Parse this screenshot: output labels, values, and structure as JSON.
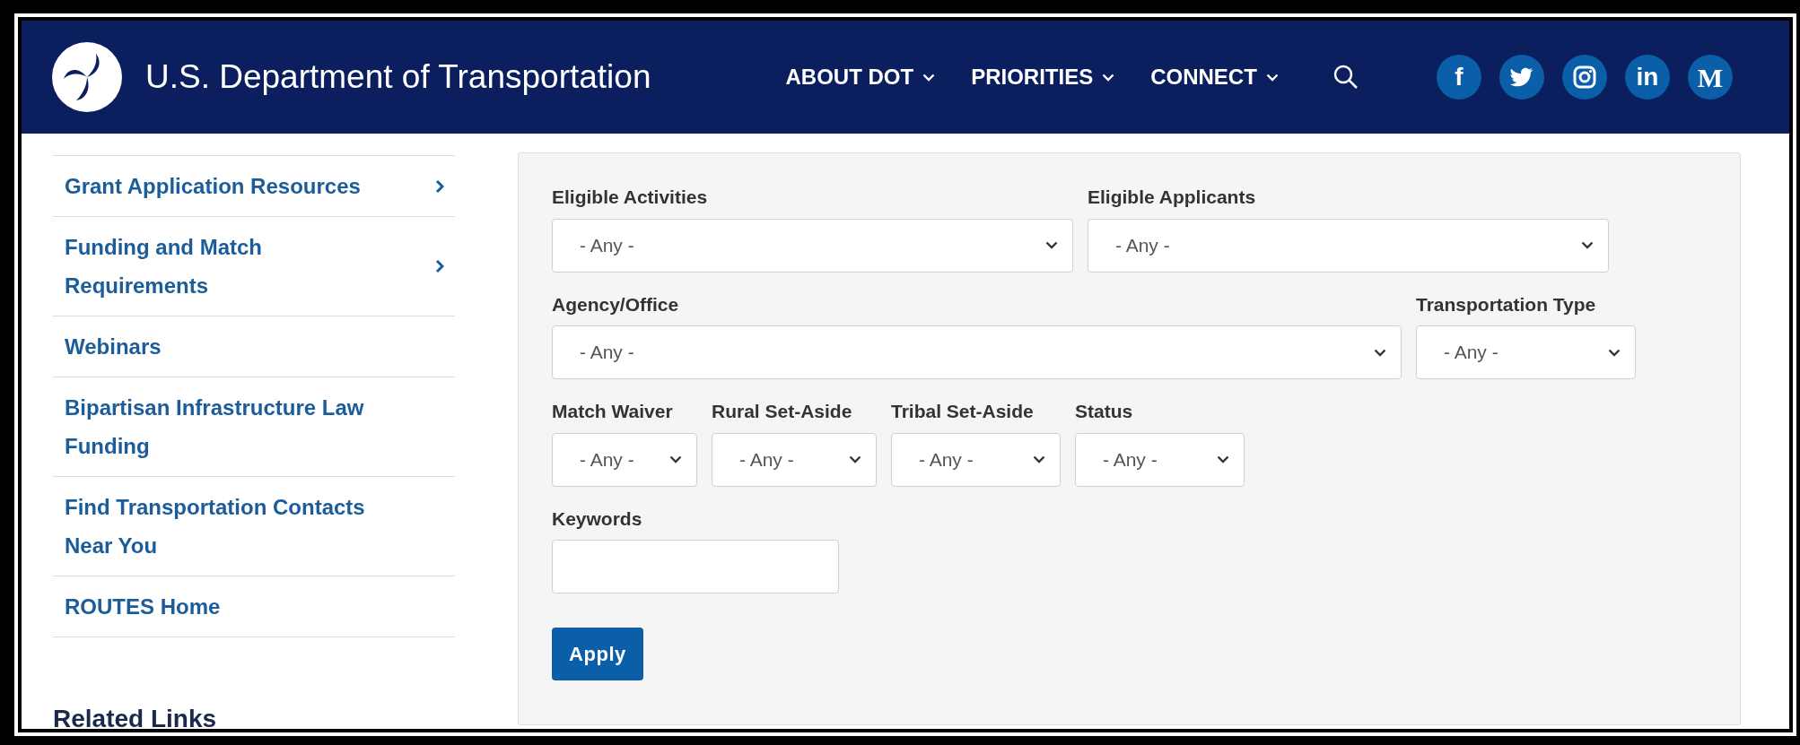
{
  "header": {
    "title": "U.S. Department of Transportation",
    "nav": [
      {
        "label": "ABOUT DOT"
      },
      {
        "label": "PRIORITIES"
      },
      {
        "label": "CONNECT"
      }
    ],
    "social": [
      {
        "kind": "glyph",
        "glyph": "f"
      },
      {
        "kind": "bird"
      },
      {
        "kind": "camera"
      },
      {
        "kind": "glyph",
        "glyph": "in"
      },
      {
        "kind": "serif",
        "glyph": "M"
      }
    ]
  },
  "sidebar": {
    "items": [
      {
        "label": "Grant Application Resources",
        "expandable": true
      },
      {
        "label": "Funding and Match Requirements",
        "expandable": true
      },
      {
        "label": "Webinars",
        "expandable": false
      },
      {
        "label": "Bipartisan Infrastructure Law Funding",
        "expandable": false
      },
      {
        "label": "Find Transportation Contacts Near You",
        "expandable": false
      },
      {
        "label": "ROUTES Home",
        "expandable": false
      }
    ],
    "heading": "Related Links"
  },
  "filters": {
    "fields": [
      {
        "kind": "select",
        "label": "Eligible Activities",
        "value": "- Any -"
      },
      {
        "kind": "select",
        "label": "Eligible Applicants",
        "value": "- Any -"
      },
      {
        "kind": "select",
        "label": "Agency/Office",
        "value": "- Any -"
      },
      {
        "kind": "select",
        "label": "Transportation Type",
        "value": "- Any -"
      },
      {
        "kind": "select",
        "label": "Match Waiver",
        "value": "- Any -"
      },
      {
        "kind": "select",
        "label": "Rural Set-Aside",
        "value": "- Any -"
      },
      {
        "kind": "select",
        "label": "Tribal Set-Aside",
        "value": "- Any -"
      },
      {
        "kind": "select",
        "label": "Status",
        "value": "- Any -"
      },
      {
        "kind": "text",
        "label": "Keywords"
      }
    ],
    "button": "Apply"
  }
}
